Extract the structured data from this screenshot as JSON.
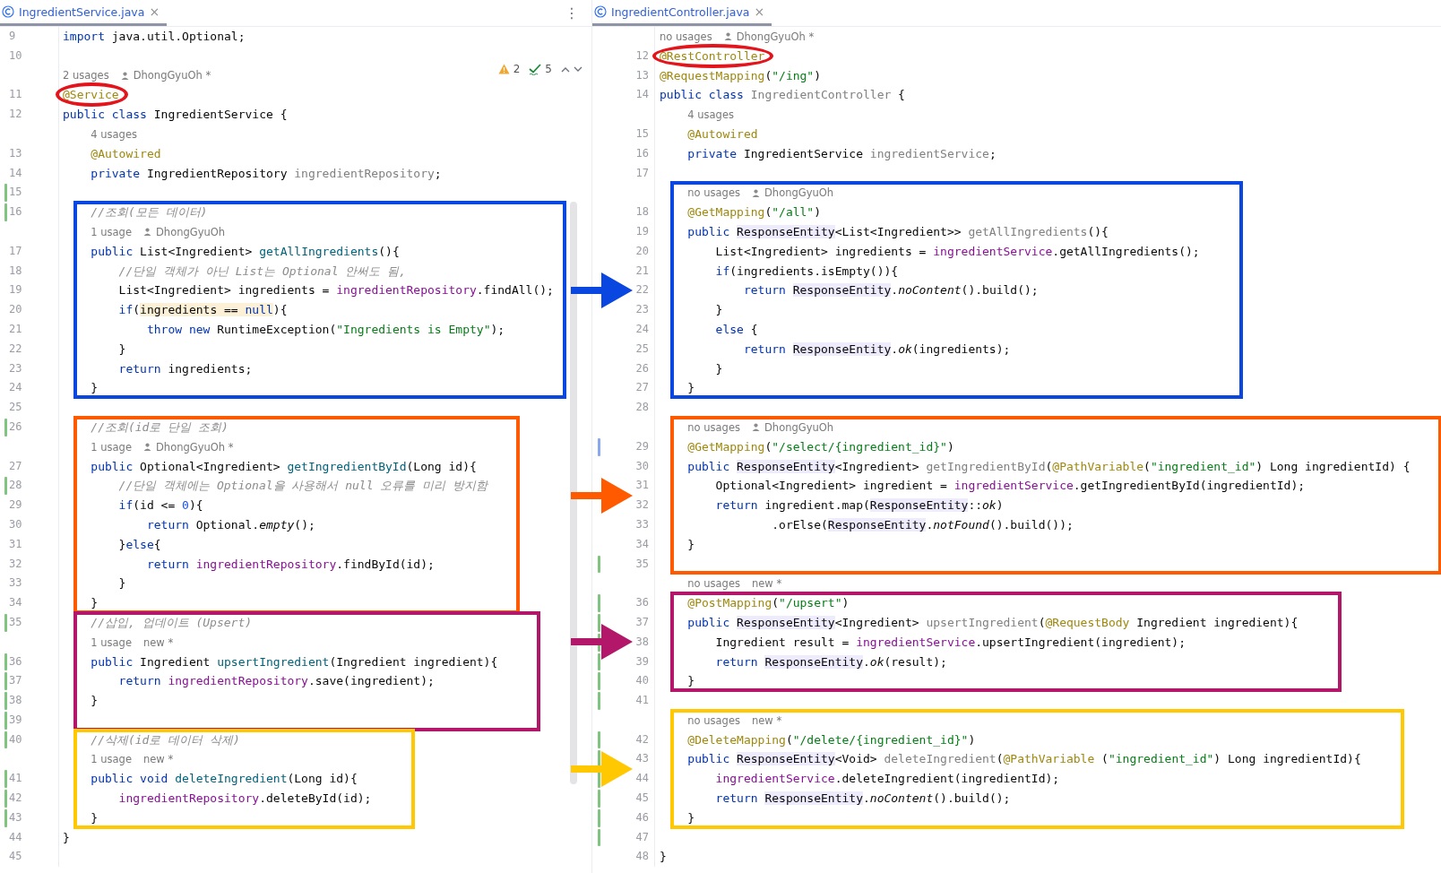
{
  "panes": [
    {
      "tab": {
        "label": "IngredientService.java",
        "close": "×",
        "selected": true
      },
      "menu": "⋮",
      "inspections": {
        "warnings": "2",
        "checks": "5"
      },
      "blocks": [
        {
          "lines": [
            {
              "kind": "code",
              "number": "9",
              "tokens": [
                {
                  "kind": "kw",
                  "text": "import"
                },
                {
                  "kind": "plain",
                  "text": " java.util.Optional;"
                }
              ]
            },
            {
              "kind": "code",
              "number": "10"
            },
            {
              "kind": "hint",
              "usages": "2 usages",
              "author": "DhongGyuOh *",
              "author_icon": true
            },
            {
              "kind": "code",
              "number": "11",
              "tokens": [
                {
                  "kind": "ann",
                  "text": "@Service",
                  "circled": true
                }
              ]
            },
            {
              "kind": "code",
              "number": "12",
              "tokens": [
                {
                  "kind": "kw",
                  "text": "public class"
                },
                {
                  "kind": "plain",
                  "text": " IngredientService {"
                }
              ]
            },
            {
              "kind": "hint",
              "usages": "4 usages"
            },
            {
              "kind": "code",
              "number": "13",
              "tokens": [
                {
                  "kind": "ann",
                  "text": "    @Autowired"
                }
              ]
            },
            {
              "kind": "code",
              "number": "14",
              "tokens": [
                {
                  "kind": "kw",
                  "text": "    private"
                },
                {
                  "kind": "plain",
                  "text": " IngredientRepository "
                },
                {
                  "kind": "muted",
                  "text": "ingredientRepository"
                },
                {
                  "kind": "plain",
                  "text": ";"
                }
              ]
            },
            {
              "kind": "code",
              "number": "15",
              "color": "#7fc47f"
            }
          ]
        },
        {
          "color": "#0a47e0",
          "lines": [
            {
              "kind": "code",
              "number": "16",
              "color": "#7fc47f",
              "tokens": [
                {
                  "kind": "comment",
                  "text": "    //조회(모든 데이터)"
                }
              ]
            },
            {
              "kind": "hint",
              "usages": "1 usage",
              "author": "DhongGyuOh",
              "author_icon": true
            },
            {
              "kind": "code",
              "number": "17",
              "tokens": [
                {
                  "kind": "kw",
                  "text": "    public"
                },
                {
                  "kind": "plain",
                  "text": " List<Ingredient> "
                },
                {
                  "kind": "fn",
                  "text": "getAllIngredients"
                },
                {
                  "kind": "plain",
                  "text": "(){"
                }
              ]
            },
            {
              "kind": "code",
              "number": "18",
              "tokens": [
                {
                  "kind": "comment",
                  "text": "        //단일 객체가 아닌 List는 Optional 안써도 됨,"
                }
              ]
            },
            {
              "kind": "code",
              "number": "19",
              "tokens": [
                {
                  "kind": "plain",
                  "text": "        List<Ingredient> ingredients = "
                },
                {
                  "kind": "field",
                  "text": "ingredientRepository"
                },
                {
                  "kind": "plain",
                  "text": ".findAll();"
                }
              ]
            },
            {
              "kind": "code",
              "number": "20",
              "tokens": [
                {
                  "kind": "kw",
                  "text": "        if"
                },
                {
                  "kind": "plain",
                  "text": "("
                },
                {
                  "kind": "hl",
                  "text": "ingredients == "
                },
                {
                  "kind": "hl-kw",
                  "text": "null"
                },
                {
                  "kind": "plain",
                  "text": "){"
                }
              ]
            },
            {
              "kind": "code",
              "number": "21",
              "tokens": [
                {
                  "kind": "kw",
                  "text": "            throw new"
                },
                {
                  "kind": "plain",
                  "text": " RuntimeException("
                },
                {
                  "kind": "str",
                  "text": "\"Ingredients is Empty\""
                },
                {
                  "kind": "plain",
                  "text": ");"
                }
              ]
            },
            {
              "kind": "code",
              "number": "22",
              "tokens": [
                {
                  "kind": "plain",
                  "text": "        }"
                }
              ]
            },
            {
              "kind": "code",
              "number": "23",
              "tokens": [
                {
                  "kind": "kw",
                  "text": "        return"
                },
                {
                  "kind": "plain",
                  "text": " ingredients;"
                }
              ]
            },
            {
              "kind": "code",
              "number": "24",
              "tokens": [
                {
                  "kind": "plain",
                  "text": "    }"
                }
              ]
            }
          ]
        },
        {
          "lines": [
            {
              "kind": "code",
              "number": "25"
            }
          ]
        },
        {
          "color": "#ff5a00",
          "lines": [
            {
              "kind": "code",
              "number": "26",
              "color": "#7fc47f",
              "tokens": [
                {
                  "kind": "comment",
                  "text": "    //조회(id로 단일 조회)"
                }
              ]
            },
            {
              "kind": "hint",
              "usages": "1 usage",
              "author": "DhongGyuOh *",
              "author_icon": true
            },
            {
              "kind": "code",
              "number": "27",
              "tokens": [
                {
                  "kind": "kw",
                  "text": "    public"
                },
                {
                  "kind": "plain",
                  "text": " Optional<Ingredient> "
                },
                {
                  "kind": "fn",
                  "text": "getIngredientById"
                },
                {
                  "kind": "plain",
                  "text": "(Long id){"
                }
              ]
            },
            {
              "kind": "code",
              "number": "28",
              "color": "#7fc47f",
              "tokens": [
                {
                  "kind": "comment",
                  "text": "        //단일 객체에는 Optional을 사용해서 null 오류를 미리 방지함"
                }
              ]
            },
            {
              "kind": "code",
              "number": "29",
              "tokens": [
                {
                  "kind": "kw",
                  "text": "        if"
                },
                {
                  "kind": "plain",
                  "text": "(id <= "
                },
                {
                  "kind": "num",
                  "text": "0"
                },
                {
                  "kind": "plain",
                  "text": "){"
                }
              ]
            },
            {
              "kind": "code",
              "number": "30",
              "tokens": [
                {
                  "kind": "kw",
                  "text": "            return"
                },
                {
                  "kind": "plain",
                  "text": " Optional."
                },
                {
                  "kind": "static",
                  "text": "empty"
                },
                {
                  "kind": "plain",
                  "text": "();"
                }
              ]
            },
            {
              "kind": "code",
              "number": "31",
              "tokens": [
                {
                  "kind": "plain",
                  "text": "        }"
                },
                {
                  "kind": "kw",
                  "text": "else"
                },
                {
                  "kind": "plain",
                  "text": "{"
                }
              ]
            },
            {
              "kind": "code",
              "number": "32",
              "tokens": [
                {
                  "kind": "kw",
                  "text": "            return "
                },
                {
                  "kind": "field",
                  "text": "ingredientRepository"
                },
                {
                  "kind": "plain",
                  "text": ".findById(id);"
                }
              ]
            },
            {
              "kind": "code",
              "number": "33",
              "tokens": [
                {
                  "kind": "plain",
                  "text": "        }"
                }
              ]
            },
            {
              "kind": "code",
              "number": "34",
              "tokens": [
                {
                  "kind": "plain",
                  "text": "    }"
                }
              ]
            }
          ]
        },
        {
          "color": "#b3176a",
          "lines": [
            {
              "kind": "code",
              "number": "35",
              "color": "#7fc47f",
              "tokens": [
                {
                  "kind": "comment",
                  "text": "    //삽입, 업데이트 (Upsert)"
                }
              ]
            },
            {
              "kind": "hint",
              "usages": "1 usage",
              "author": "new *",
              "author_icon": false
            },
            {
              "kind": "code",
              "number": "36",
              "color": "#7fc47f",
              "tokens": [
                {
                  "kind": "kw",
                  "text": "    public"
                },
                {
                  "kind": "plain",
                  "text": " Ingredient "
                },
                {
                  "kind": "fn",
                  "text": "upsertIngredient"
                },
                {
                  "kind": "plain",
                  "text": "(Ingredient ingredient){"
                }
              ]
            },
            {
              "kind": "code",
              "number": "37",
              "color": "#7fc47f",
              "tokens": [
                {
                  "kind": "kw",
                  "text": "        return "
                },
                {
                  "kind": "field",
                  "text": "ingredientRepository"
                },
                {
                  "kind": "plain",
                  "text": ".save(ingredient);"
                }
              ]
            },
            {
              "kind": "code",
              "number": "38",
              "color": "#7fc47f",
              "tokens": [
                {
                  "kind": "plain",
                  "text": "    }"
                }
              ]
            },
            {
              "kind": "code",
              "number": "39",
              "color": "#7fc47f"
            }
          ]
        },
        {
          "color": "#ffc800",
          "lines": [
            {
              "kind": "code",
              "number": "40",
              "color": "#7fc47f",
              "tokens": [
                {
                  "kind": "comment",
                  "text": "    //삭제(id로 데이터 삭제)"
                }
              ]
            },
            {
              "kind": "hint",
              "usages": "1 usage",
              "author": "new *",
              "author_icon": false
            },
            {
              "kind": "code",
              "number": "41",
              "color": "#7fc47f",
              "tokens": [
                {
                  "kind": "kw",
                  "text": "    public void "
                },
                {
                  "kind": "fn",
                  "text": "deleteIngredient"
                },
                {
                  "kind": "plain",
                  "text": "(Long id){"
                }
              ]
            },
            {
              "kind": "code",
              "number": "42",
              "color": "#7fc47f",
              "tokens": [
                {
                  "kind": "field",
                  "text": "        ingredientRepository"
                },
                {
                  "kind": "plain",
                  "text": ".deleteById(id);"
                }
              ]
            },
            {
              "kind": "code",
              "number": "43",
              "color": "#7fc47f",
              "tokens": [
                {
                  "kind": "plain",
                  "text": "    }"
                }
              ]
            }
          ]
        },
        {
          "lines": [
            {
              "kind": "code",
              "number": "44",
              "tokens": [
                {
                  "kind": "plain",
                  "text": "}"
                }
              ]
            },
            {
              "kind": "code",
              "number": "45"
            }
          ]
        }
      ]
    },
    {
      "tab": {
        "label": "IngredientController.java",
        "close": "×",
        "selected": true
      },
      "blocks": [
        {
          "lines": [
            {
              "kind": "hint",
              "usages": "no usages",
              "author": "DhongGyuOh *",
              "author_icon": true
            },
            {
              "kind": "code",
              "number": "12",
              "tokens": [
                {
                  "kind": "ann",
                  "text": "@RestController",
                  "circled": true
                }
              ]
            },
            {
              "kind": "code",
              "number": "13",
              "tokens": [
                {
                  "kind": "ann",
                  "text": "@RequestMapping"
                },
                {
                  "kind": "plain",
                  "text": "("
                },
                {
                  "kind": "str",
                  "text": "\"/ing\""
                },
                {
                  "kind": "plain",
                  "text": ")"
                }
              ]
            },
            {
              "kind": "code",
              "number": "14",
              "tokens": [
                {
                  "kind": "kw",
                  "text": "public class "
                },
                {
                  "kind": "muted",
                  "text": "IngredientController"
                },
                {
                  "kind": "plain",
                  "text": " {"
                }
              ]
            },
            {
              "kind": "hint",
              "usages": "4 usages"
            },
            {
              "kind": "code",
              "number": "15",
              "tokens": [
                {
                  "kind": "ann",
                  "text": "    @Autowired"
                }
              ]
            },
            {
              "kind": "code",
              "number": "16",
              "tokens": [
                {
                  "kind": "kw",
                  "text": "    private"
                },
                {
                  "kind": "plain",
                  "text": " IngredientService "
                },
                {
                  "kind": "muted",
                  "text": "ingredientService"
                },
                {
                  "kind": "plain",
                  "text": ";"
                }
              ]
            },
            {
              "kind": "code",
              "number": "17"
            }
          ]
        },
        {
          "color": "#0a47e0",
          "arrow": true,
          "lines": [
            {
              "kind": "hint",
              "usages": "no usages",
              "author": "DhongGyuOh",
              "author_icon": true
            },
            {
              "kind": "code",
              "number": "18",
              "tokens": [
                {
                  "kind": "ann",
                  "text": "    @GetMapping"
                },
                {
                  "kind": "plain",
                  "text": "("
                },
                {
                  "kind": "str",
                  "text": "\"/all\""
                },
                {
                  "kind": "plain",
                  "text": ")"
                }
              ]
            },
            {
              "kind": "code",
              "number": "19",
              "tokens": [
                {
                  "kind": "kw",
                  "text": "    public "
                },
                {
                  "kind": "ref",
                  "text": "ResponseEntity"
                },
                {
                  "kind": "plain",
                  "text": "<List<Ingredient>> "
                },
                {
                  "kind": "muted",
                  "text": "getAllIngredients"
                },
                {
                  "kind": "plain",
                  "text": "(){"
                }
              ]
            },
            {
              "kind": "code",
              "number": "20",
              "tokens": [
                {
                  "kind": "plain",
                  "text": "        List<Ingredient> ingredients = "
                },
                {
                  "kind": "field",
                  "text": "ingredientService"
                },
                {
                  "kind": "plain",
                  "text": ".getAllIngredients();"
                }
              ]
            },
            {
              "kind": "code",
              "number": "21",
              "tokens": [
                {
                  "kind": "kw",
                  "text": "        if"
                },
                {
                  "kind": "plain",
                  "text": "(ingredients.isEmpty()){"
                }
              ]
            },
            {
              "kind": "code",
              "number": "22",
              "tokens": [
                {
                  "kind": "kw",
                  "text": "            return "
                },
                {
                  "kind": "ref",
                  "text": "ResponseEntity"
                },
                {
                  "kind": "plain",
                  "text": "."
                },
                {
                  "kind": "static",
                  "text": "noContent"
                },
                {
                  "kind": "plain",
                  "text": "().build();"
                }
              ]
            },
            {
              "kind": "code",
              "number": "23",
              "tokens": [
                {
                  "kind": "plain",
                  "text": "        }"
                }
              ]
            },
            {
              "kind": "code",
              "number": "24",
              "tokens": [
                {
                  "kind": "kw",
                  "text": "        else"
                },
                {
                  "kind": "plain",
                  "text": " {"
                }
              ]
            },
            {
              "kind": "code",
              "number": "25",
              "tokens": [
                {
                  "kind": "kw",
                  "text": "            return "
                },
                {
                  "kind": "ref",
                  "text": "ResponseEntity"
                },
                {
                  "kind": "plain",
                  "text": "."
                },
                {
                  "kind": "static",
                  "text": "ok"
                },
                {
                  "kind": "plain",
                  "text": "(ingredients);"
                }
              ]
            },
            {
              "kind": "code",
              "number": "26",
              "tokens": [
                {
                  "kind": "plain",
                  "text": "        }"
                }
              ]
            },
            {
              "kind": "code",
              "number": "27",
              "tokens": [
                {
                  "kind": "plain",
                  "text": "    }"
                }
              ]
            }
          ]
        },
        {
          "lines": [
            {
              "kind": "code",
              "number": "28"
            }
          ]
        },
        {
          "color": "#ff5a00",
          "arrow": true,
          "lines": [
            {
              "kind": "hint",
              "usages": "no usages",
              "author": "DhongGyuOh",
              "author_icon": true
            },
            {
              "kind": "code",
              "number": "29",
              "color": "#8aa8ef",
              "tokens": [
                {
                  "kind": "ann",
                  "text": "    @GetMapping"
                },
                {
                  "kind": "plain",
                  "text": "("
                },
                {
                  "kind": "str",
                  "text": "\"/select/{ingredient_id}\""
                },
                {
                  "kind": "plain",
                  "text": ")"
                }
              ]
            },
            {
              "kind": "code",
              "number": "30",
              "tokens": [
                {
                  "kind": "kw",
                  "text": "    public "
                },
                {
                  "kind": "ref",
                  "text": "ResponseEntity"
                },
                {
                  "kind": "plain",
                  "text": "<Ingredient> "
                },
                {
                  "kind": "muted",
                  "text": "getIngredientById"
                },
                {
                  "kind": "plain",
                  "text": "("
                },
                {
                  "kind": "ann",
                  "text": "@PathVariable"
                },
                {
                  "kind": "plain",
                  "text": "("
                },
                {
                  "kind": "str",
                  "text": "\"ingredient_id\""
                },
                {
                  "kind": "plain",
                  "text": ") Long ingredientId) {"
                }
              ]
            },
            {
              "kind": "code",
              "number": "31",
              "tokens": [
                {
                  "kind": "plain",
                  "text": "        Optional<Ingredient> ingredient = "
                },
                {
                  "kind": "field",
                  "text": "ingredientService"
                },
                {
                  "kind": "plain",
                  "text": ".getIngredientById(ingredientId);"
                }
              ]
            },
            {
              "kind": "code",
              "number": "32",
              "tokens": [
                {
                  "kind": "kw",
                  "text": "        return"
                },
                {
                  "kind": "plain",
                  "text": " ingredient.map("
                },
                {
                  "kind": "ref",
                  "text": "ResponseEntity"
                },
                {
                  "kind": "plain",
                  "text": "::"
                },
                {
                  "kind": "static",
                  "text": "ok"
                },
                {
                  "kind": "plain",
                  "text": ")"
                }
              ]
            },
            {
              "kind": "code",
              "number": "33",
              "tokens": [
                {
                  "kind": "plain",
                  "text": "                .orElse("
                },
                {
                  "kind": "ref",
                  "text": "ResponseEntity"
                },
                {
                  "kind": "plain",
                  "text": "."
                },
                {
                  "kind": "static",
                  "text": "notFound"
                },
                {
                  "kind": "plain",
                  "text": "().build());"
                }
              ]
            },
            {
              "kind": "code",
              "number": "34",
              "tokens": [
                {
                  "kind": "plain",
                  "text": "    }"
                }
              ]
            },
            {
              "kind": "code",
              "number": "35",
              "color": "#7fc47f"
            }
          ]
        },
        {
          "lines": [
            {
              "kind": "hint",
              "usages": "no usages",
              "author": "new *",
              "author_icon": false
            }
          ]
        },
        {
          "color": "#b3176a",
          "arrow": true,
          "lines": [
            {
              "kind": "code",
              "number": "36",
              "color": "#7fc47f",
              "tokens": [
                {
                  "kind": "ann",
                  "text": "    @PostMapping"
                },
                {
                  "kind": "plain",
                  "text": "("
                },
                {
                  "kind": "str",
                  "text": "\"/upsert\""
                },
                {
                  "kind": "plain",
                  "text": ")"
                }
              ]
            },
            {
              "kind": "code",
              "number": "37",
              "color": "#7fc47f",
              "tokens": [
                {
                  "kind": "kw",
                  "text": "    public "
                },
                {
                  "kind": "ref",
                  "text": "ResponseEntity"
                },
                {
                  "kind": "plain",
                  "text": "<Ingredient> "
                },
                {
                  "kind": "muted",
                  "text": "upsertIngredient"
                },
                {
                  "kind": "plain",
                  "text": "("
                },
                {
                  "kind": "ann",
                  "text": "@RequestBody"
                },
                {
                  "kind": "plain",
                  "text": " Ingredient ingredient){"
                }
              ]
            },
            {
              "kind": "code",
              "number": "38",
              "color": "#7fc47f",
              "tokens": [
                {
                  "kind": "plain",
                  "text": "        Ingredient result = "
                },
                {
                  "kind": "field",
                  "text": "ingredientService"
                },
                {
                  "kind": "plain",
                  "text": ".upsertIngredient(ingredient);"
                }
              ]
            },
            {
              "kind": "code",
              "number": "39",
              "color": "#7fc47f",
              "tokens": [
                {
                  "kind": "kw",
                  "text": "        return "
                },
                {
                  "kind": "ref",
                  "text": "ResponseEntity"
                },
                {
                  "kind": "plain",
                  "text": "."
                },
                {
                  "kind": "static",
                  "text": "ok"
                },
                {
                  "kind": "plain",
                  "text": "(result);"
                }
              ]
            },
            {
              "kind": "code",
              "number": "40",
              "color": "#7fc47f",
              "tokens": [
                {
                  "kind": "plain",
                  "text": "    }"
                }
              ]
            }
          ]
        },
        {
          "lines": [
            {
              "kind": "code",
              "number": "41",
              "color": "#7fc47f"
            }
          ]
        },
        {
          "color": "#ffc800",
          "arrow": true,
          "lines": [
            {
              "kind": "hint",
              "usages": "no usages",
              "author": "new *",
              "author_icon": false
            },
            {
              "kind": "code",
              "number": "42",
              "color": "#7fc47f",
              "tokens": [
                {
                  "kind": "ann",
                  "text": "    @DeleteMapping"
                },
                {
                  "kind": "plain",
                  "text": "("
                },
                {
                  "kind": "str",
                  "text": "\"/delete/{ingredient_id}\""
                },
                {
                  "kind": "plain",
                  "text": ")"
                }
              ]
            },
            {
              "kind": "code",
              "number": "43",
              "color": "#7fc47f",
              "tokens": [
                {
                  "kind": "kw",
                  "text": "    public "
                },
                {
                  "kind": "ref",
                  "text": "ResponseEntity"
                },
                {
                  "kind": "plain",
                  "text": "<Void> "
                },
                {
                  "kind": "muted",
                  "text": "deleteIngredient"
                },
                {
                  "kind": "plain",
                  "text": "("
                },
                {
                  "kind": "ann",
                  "text": "@PathVariable"
                },
                {
                  "kind": "plain",
                  "text": " ("
                },
                {
                  "kind": "str",
                  "text": "\"ingredient_id\""
                },
                {
                  "kind": "plain",
                  "text": ") Long ingredientId){"
                }
              ]
            },
            {
              "kind": "code",
              "number": "44",
              "color": "#7fc47f",
              "tokens": [
                {
                  "kind": "field",
                  "text": "        ingredientService"
                },
                {
                  "kind": "plain",
                  "text": ".deleteIngredient(ingredientId);"
                }
              ]
            },
            {
              "kind": "code",
              "number": "45",
              "color": "#7fc47f",
              "tokens": [
                {
                  "kind": "kw",
                  "text": "        return "
                },
                {
                  "kind": "ref",
                  "text": "ResponseEntity"
                },
                {
                  "kind": "plain",
                  "text": "."
                },
                {
                  "kind": "static",
                  "text": "noContent"
                },
                {
                  "kind": "plain",
                  "text": "().build();"
                }
              ]
            },
            {
              "kind": "code",
              "number": "46",
              "color": "#7fc47f",
              "tokens": [
                {
                  "kind": "plain",
                  "text": "    }"
                }
              ]
            }
          ]
        },
        {
          "lines": [
            {
              "kind": "code",
              "number": "47",
              "color": "#7fc47f"
            },
            {
              "kind": "code",
              "number": "48",
              "tokens": [
                {
                  "kind": "plain",
                  "text": "}"
                }
              ]
            }
          ]
        }
      ]
    }
  ]
}
